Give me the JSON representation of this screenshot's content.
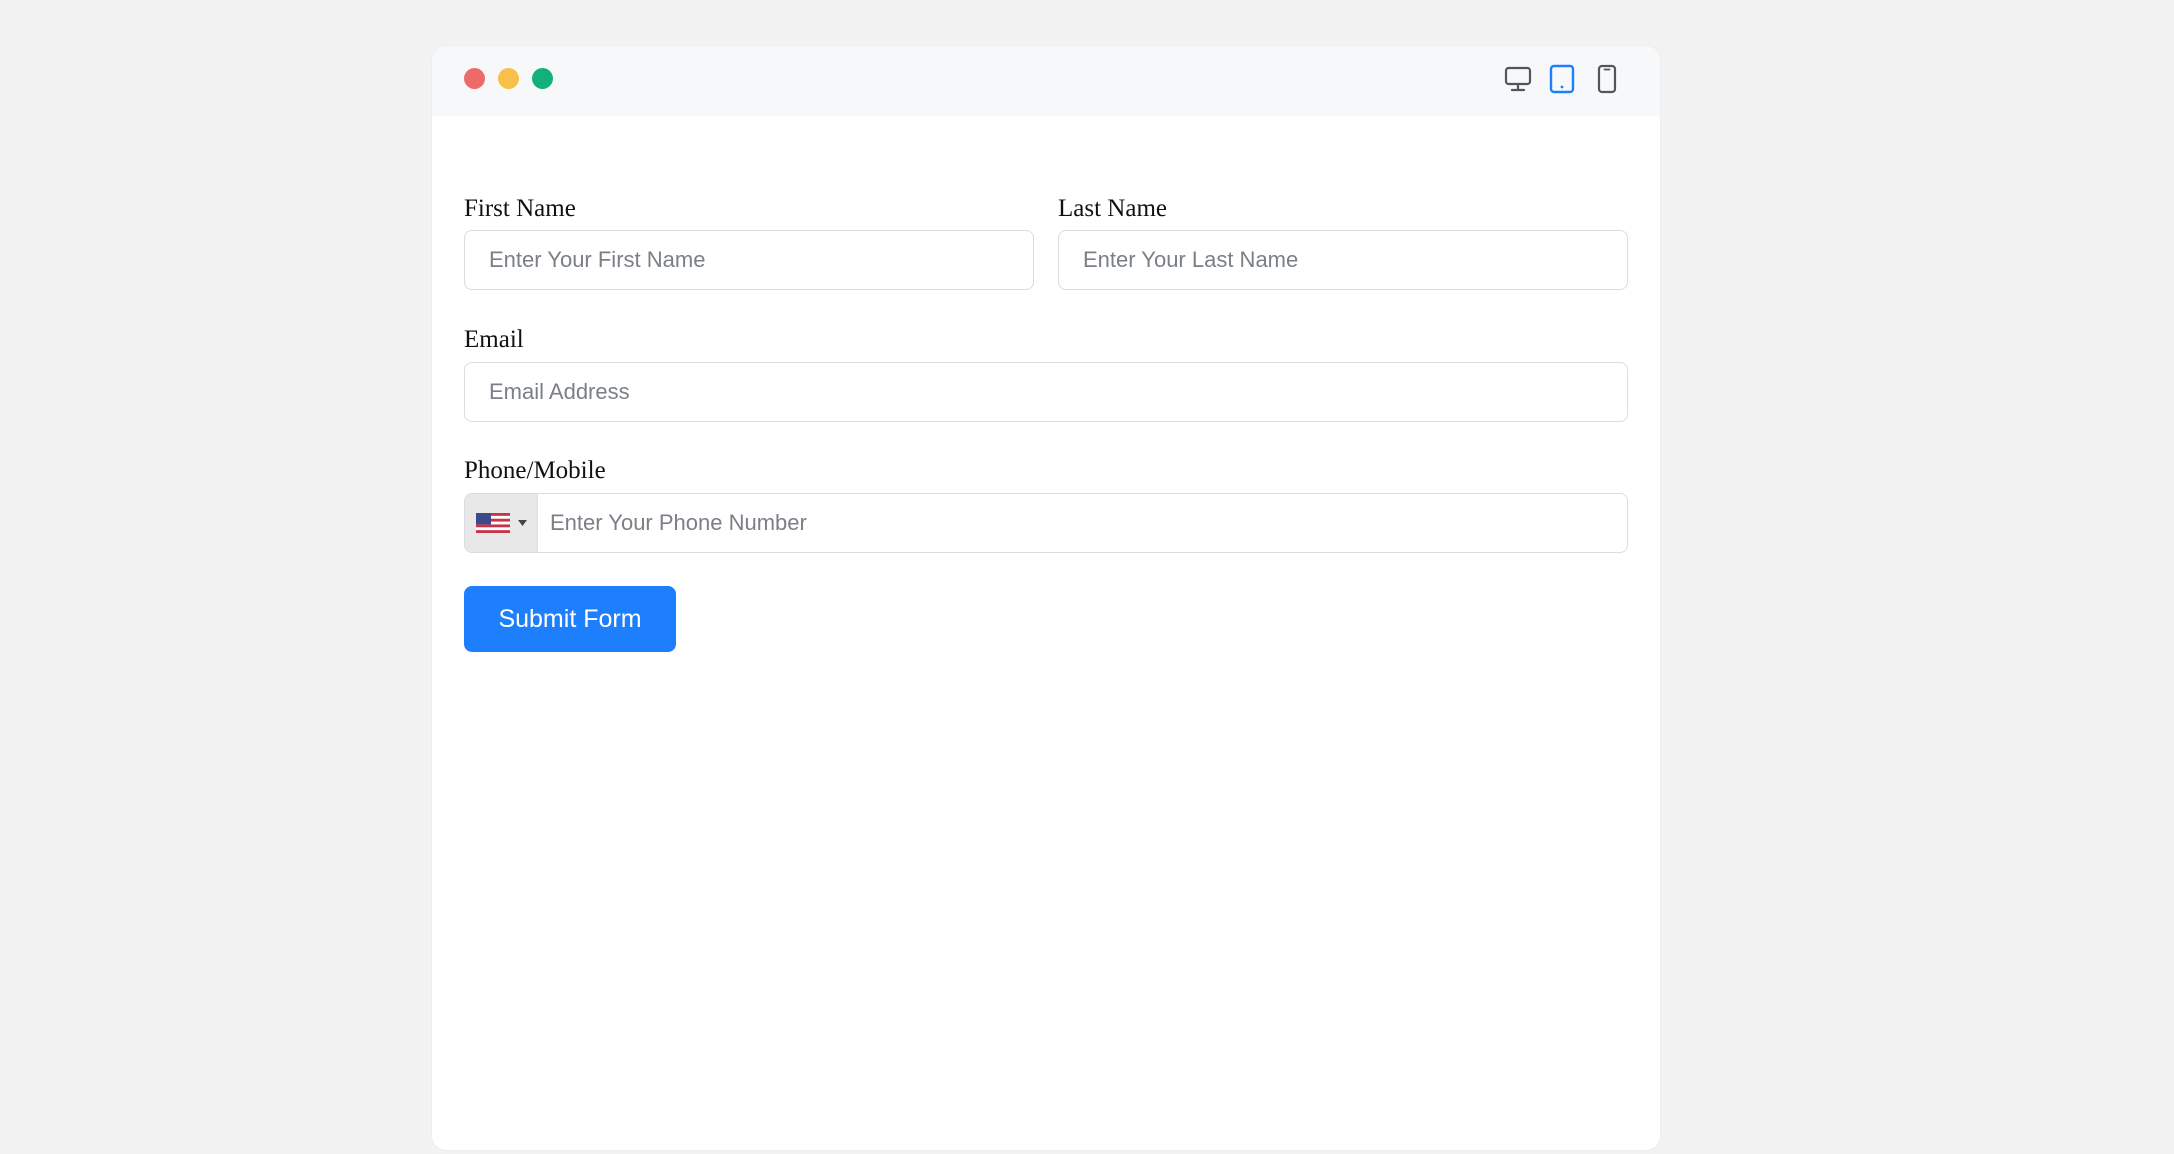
{
  "window": {
    "device_icons": [
      "desktop-icon",
      "tablet-icon",
      "mobile-icon"
    ],
    "active_device": "tablet",
    "colors": {
      "close": "#ec6a6a",
      "minimize": "#f7c04a",
      "maximize": "#14b07a",
      "accent": "#1e7ffc"
    }
  },
  "form": {
    "first_name": {
      "label": "First Name",
      "placeholder": "Enter Your First Name",
      "value": ""
    },
    "last_name": {
      "label": "Last Name",
      "placeholder": "Enter Your Last Name",
      "value": ""
    },
    "email": {
      "label": "Email",
      "placeholder": "Email Address",
      "value": ""
    },
    "phone": {
      "label": "Phone/Mobile",
      "placeholder": "Enter Your Phone Number",
      "value": "",
      "country_flag": "us-flag-icon"
    },
    "submit_label": "Submit Form"
  }
}
